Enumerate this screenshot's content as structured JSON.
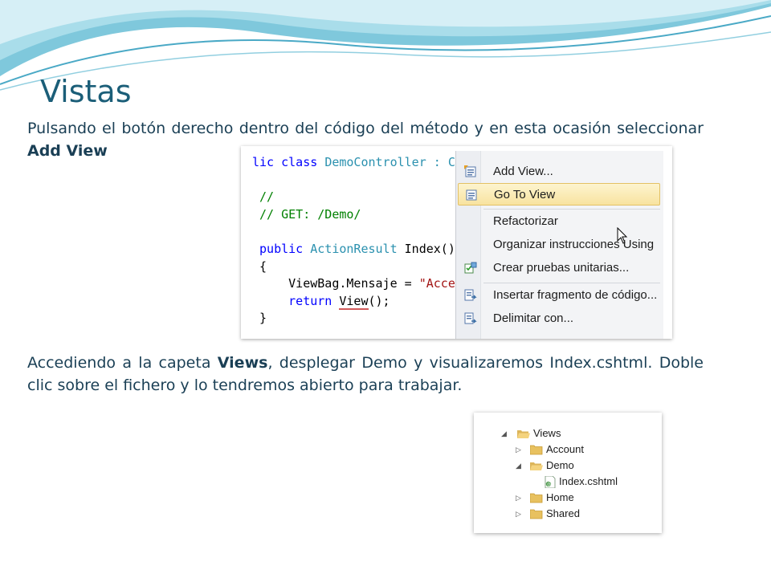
{
  "slide": {
    "title": "Vistas",
    "para1_text": "Pulsando el botón derecho dentro del código del método y en esta ocasión seleccionar ",
    "para1_bold": "Add View",
    "para2_pre": "Accediendo a la capeta ",
    "para2_bold": "Views",
    "para2_post": ", desplegar Demo y visualizaremos Index.cshtml. Doble clic sobre el fichero y lo tendremos abierto para trabajar."
  },
  "code": {
    "l1_kw": "lic class ",
    "l1_type": "DemoController",
    "l1_rest": " : C",
    "l3": "//",
    "l4": "// GET: /Demo/",
    "l6_kw": "public ",
    "l6_type": "ActionResult",
    "l6_rest": " Index()",
    "l7": "{",
    "l8_pre": "    ViewBag.Mensaje = ",
    "l8_str": "\"Acce",
    "l9_kw": "    return ",
    "l9_call": "View",
    "l9_rest": "();",
    "l10": "}"
  },
  "context_menu": {
    "items": [
      {
        "label": "Add View...",
        "icon": "add-view-icon"
      },
      {
        "label": "Go To View",
        "icon": "go-to-view-icon",
        "highlighted": true
      },
      {
        "label": "Refactorizar",
        "icon": ""
      },
      {
        "label": "Organizar instrucciones Using",
        "icon": ""
      },
      {
        "label": "Crear pruebas unitarias...",
        "icon": "unit-test-icon"
      },
      {
        "label": "Insertar fragmento de código...",
        "icon": "snippet-icon"
      },
      {
        "label": "Delimitar con...",
        "icon": "surround-icon"
      }
    ]
  },
  "tree": {
    "items": [
      {
        "label": "Views",
        "expanded": true
      },
      {
        "label": "Account",
        "expanded": false
      },
      {
        "label": "Demo",
        "expanded": true
      },
      {
        "label": "Index.cshtml",
        "file": true
      },
      {
        "label": "Home",
        "expanded": false
      },
      {
        "label": "Shared",
        "expanded": false
      }
    ]
  },
  "colors": {
    "title": "#1b5e78",
    "text": "#1a3f55",
    "keyword": "#0000ff",
    "type": "#2b91af",
    "comment": "#008000",
    "string": "#a31515",
    "highlight": "#f8e3a0"
  }
}
